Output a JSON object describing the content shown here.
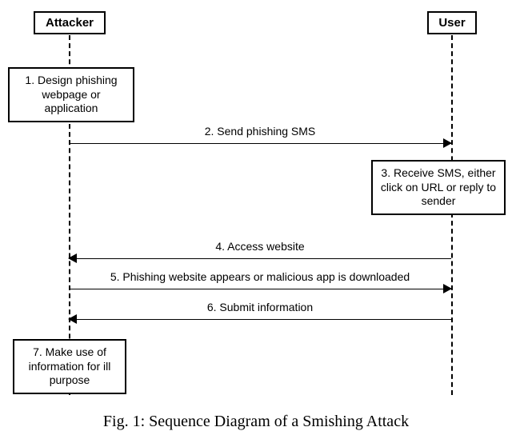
{
  "actors": {
    "attacker": "Attacker",
    "user": "User"
  },
  "steps": {
    "s1": "1. Design phishing webpage or application",
    "s3": "3. Receive SMS, either click on URL or reply to sender",
    "s7": "7. Make use of information for ill purpose"
  },
  "messages": {
    "m2": "2. Send phishing SMS",
    "m4": "4. Access website",
    "m5": "5. Phishing website appears or malicious app is downloaded",
    "m6": "6. Submit information"
  },
  "caption": "Fig. 1: Sequence Diagram of a Smishing Attack"
}
